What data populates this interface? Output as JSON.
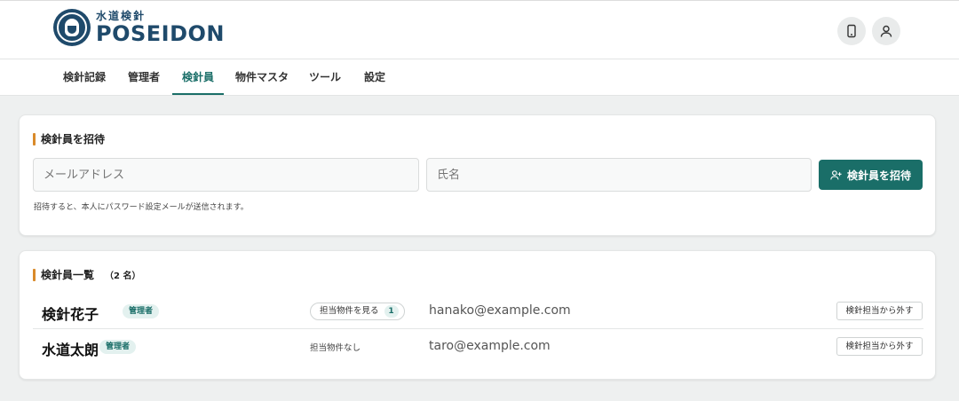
{
  "brand": {
    "name": "POSEIDON",
    "subtitle": "水道検針"
  },
  "header": {
    "phone_icon": "smartphone-icon",
    "user_icon": "user-icon"
  },
  "nav": {
    "tabs": [
      {
        "label": "検針記録"
      },
      {
        "label": "管理者"
      },
      {
        "label": "検針員",
        "active": true
      },
      {
        "label": "物件マスタ"
      },
      {
        "label": "ツール"
      },
      {
        "label": "設定"
      }
    ]
  },
  "invite": {
    "title": "検針員を招待",
    "email_placeholder": "メールアドレス",
    "name_placeholder": "氏名",
    "button_label": "検針員を招待",
    "hint": "招待すると、本人にパスワード設定メールが送信されます。"
  },
  "members": {
    "title": "検針員一覧",
    "count_label": "（2 名）",
    "rows": [
      {
        "name": "検針花子",
        "badge": "管理者",
        "properties_label": "担当物件を見る",
        "properties_count": "1",
        "email": "hanako@example.com",
        "remove_label": "検針担当から外す"
      },
      {
        "name": "水道太朗",
        "badge": "管理者",
        "properties_label": "担当物件なし",
        "email": "taro@example.com",
        "remove_label": "検針担当から外す"
      }
    ]
  },
  "colors": {
    "accent": "#1a6e68",
    "brand": "#1f4a6b",
    "section_marker": "#d98a2a"
  }
}
